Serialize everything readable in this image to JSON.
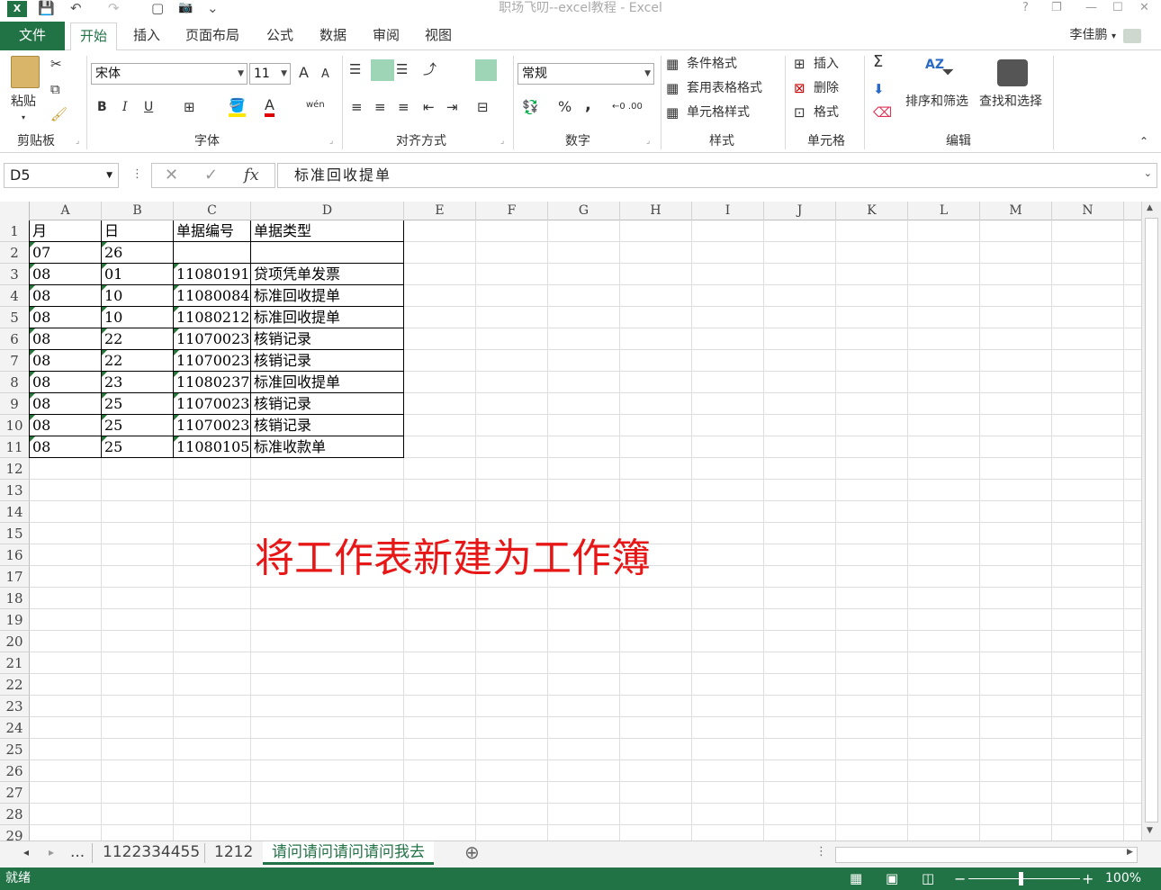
{
  "window": {
    "title": "职场飞叨--excel教程 - Excel",
    "help": "?",
    "restore": "❐",
    "minimize": "—",
    "maximize": "☐",
    "close": "✕",
    "file_icon": "excel-logo-icon"
  },
  "quick_access": {
    "save": "💾",
    "undo": "↶",
    "redo": "↷",
    "new": "▢",
    "camera": "📷",
    "customize": "⌄"
  },
  "tabs": {
    "file": "文件",
    "items": [
      "开始",
      "插入",
      "页面布局",
      "公式",
      "数据",
      "审阅",
      "视图"
    ],
    "active": 0
  },
  "user": {
    "name": "李佳鹏",
    "menu": "▾"
  },
  "ribbon": {
    "clipboard": {
      "label": "剪贴板",
      "paste": "粘贴"
    },
    "font": {
      "label": "字体",
      "name": "宋体",
      "size": "11",
      "bold": "B",
      "italic": "I",
      "underline": "U",
      "grow": "A",
      "shrink": "A",
      "wen": "wén",
      "fill_a": "A"
    },
    "alignment": {
      "label": "对齐方式"
    },
    "number": {
      "label": "数字",
      "format": "常规",
      "percent": "%",
      "comma": ",",
      "inc": "←0\n.00",
      "dec": ".00\n→.0"
    },
    "styles": {
      "label": "样式",
      "conditional": "条件格式",
      "table": "套用表格格式",
      "cell": "单元格样式"
    },
    "cells": {
      "label": "单元格",
      "insert": "插入",
      "delete": "删除",
      "format": "格式"
    },
    "editing": {
      "label": "编辑",
      "sum": "Σ",
      "sort": "排序和筛选",
      "find": "查找和选择"
    }
  },
  "formula_bar": {
    "name_box": "D5",
    "cancel": "✕",
    "enter": "✓",
    "fx": "fx",
    "content": "标准回收提单"
  },
  "columns": [
    "A",
    "B",
    "C",
    "D",
    "E",
    "F",
    "G",
    "H",
    "I",
    "J",
    "K",
    "L",
    "M",
    "N"
  ],
  "rows": [
    "1",
    "2",
    "3",
    "4",
    "5",
    "6",
    "7",
    "8",
    "9",
    "10",
    "11",
    "12",
    "13",
    "14",
    "15",
    "16",
    "17",
    "18",
    "19",
    "20",
    "21",
    "22",
    "23",
    "24",
    "25",
    "26",
    "27",
    "28",
    "29"
  ],
  "table": [
    [
      "月",
      "日",
      "单据编号",
      "单据类型"
    ],
    [
      "07",
      "26",
      "",
      ""
    ],
    [
      "08",
      "01",
      "11080191",
      "贷项凭单发票"
    ],
    [
      "08",
      "10",
      "11080084",
      "标准回收提单"
    ],
    [
      "08",
      "10",
      "11080212",
      "标准回收提单"
    ],
    [
      "08",
      "22",
      "11070023",
      "核销记录"
    ],
    [
      "08",
      "22",
      "11070023",
      "核销记录"
    ],
    [
      "08",
      "23",
      "11080237",
      "标准回收提单"
    ],
    [
      "08",
      "25",
      "11070023",
      "核销记录"
    ],
    [
      "08",
      "25",
      "11070023",
      "核销记录"
    ],
    [
      "08",
      "25",
      "11080105",
      "标准收款单"
    ]
  ],
  "overlay_text": "将工作表新建为工作簿",
  "sheets": {
    "nav_prev": "◂",
    "nav_next": "▸",
    "more": "...",
    "items": [
      "1122334455",
      "1212",
      "请问请问请问请问我去"
    ],
    "active": 2,
    "add": "⊕"
  },
  "status": {
    "ready": "就绪",
    "zoom": "100%",
    "minus": "−",
    "plus": "+"
  },
  "colors": {
    "accent": "#217346",
    "overlay": "#e81717"
  }
}
